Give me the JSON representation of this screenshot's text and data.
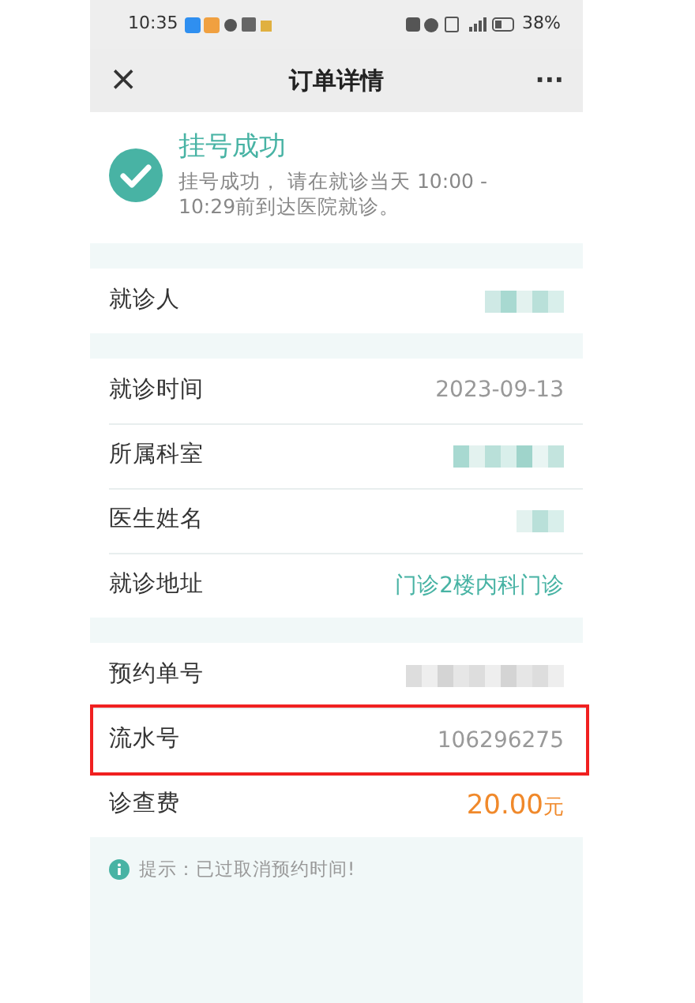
{
  "status_bar": {
    "time": "10:35",
    "battery": "38%"
  },
  "nav": {
    "close": "×",
    "title": "订单详情",
    "more": "···"
  },
  "result": {
    "title": "挂号成功",
    "message": "挂号成功， 请在就诊当天 10:00 - 10:29前到达医院就诊。"
  },
  "sections": [
    {
      "rows": [
        {
          "label": "就诊人",
          "kind": "redacted",
          "highlighted": false
        }
      ]
    },
    {
      "rows": [
        {
          "label": "就诊时间",
          "value": "2023-09-13",
          "kind": "text",
          "highlighted": false
        },
        {
          "label": "所属科室",
          "kind": "redacted",
          "highlighted": false
        },
        {
          "label": "医生姓名",
          "kind": "redacted",
          "highlighted": false
        },
        {
          "label": "就诊地址",
          "value": "门诊2楼内科门诊",
          "kind": "link",
          "highlighted": false
        }
      ]
    },
    {
      "rows": [
        {
          "label": "预约单号",
          "kind": "redacted",
          "highlighted": false
        },
        {
          "label": "流水号",
          "value": "106296275",
          "kind": "text",
          "highlighted": true
        },
        {
          "label": "诊查费",
          "value": "20.00",
          "unit": "元",
          "kind": "price",
          "highlighted": false
        }
      ]
    }
  ],
  "tip": "提示：已过取消预约时间!"
}
